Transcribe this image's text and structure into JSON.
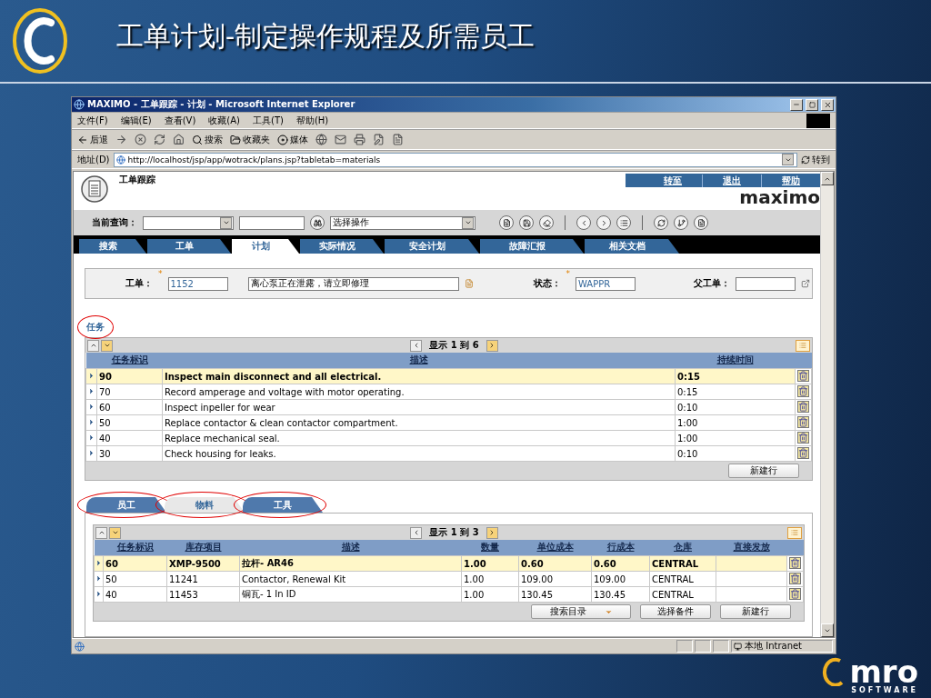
{
  "slide": {
    "title": "工单计划-制定操作规程及所需员工"
  },
  "window": {
    "title": "MAXIMO - 工单跟踪 - 计划 - Microsoft Internet Explorer"
  },
  "menu": [
    "文件(F)",
    "编辑(E)",
    "查看(V)",
    "收藏(A)",
    "工具(T)",
    "帮助(H)"
  ],
  "toolbar": [
    {
      "kind": "back",
      "label": "后退"
    },
    {
      "kind": "forward"
    },
    {
      "kind": "stop"
    },
    {
      "kind": "refresh"
    },
    {
      "kind": "home"
    },
    {
      "kind": "search",
      "label": "搜索"
    },
    {
      "kind": "favorites",
      "label": "收藏夹"
    },
    {
      "kind": "media",
      "label": "媒体"
    },
    {
      "kind": "history"
    },
    {
      "kind": "mail"
    },
    {
      "kind": "print"
    },
    {
      "kind": "edit"
    },
    {
      "kind": "discuss"
    }
  ],
  "address": {
    "label": "地址(D)",
    "url": "http://localhost/jsp/app/wotrack/plans.jsp?tabletab=materials",
    "go": "转到"
  },
  "app": {
    "name": "工单跟踪",
    "links": [
      "转至",
      "退出",
      "帮助"
    ],
    "brand": "maximo",
    "query_label": "当前查询：",
    "action": "选择操作"
  },
  "tabs": [
    {
      "label": "搜索",
      "selected": false
    },
    {
      "label": "工单",
      "selected": false
    },
    {
      "label": "计划",
      "selected": true
    },
    {
      "label": "实际情况",
      "selected": false
    },
    {
      "label": "安全计划",
      "selected": false
    },
    {
      "label": "故障汇报",
      "selected": false
    },
    {
      "label": "相关文档",
      "selected": false
    }
  ],
  "record": {
    "required_mark": "*",
    "wo_label": "工单：",
    "wo": "1152",
    "description": "离心泵正在泄露，请立即修理",
    "status_label": "状态：",
    "status": "WAPPR",
    "parent_label": "父工单："
  },
  "tasks": {
    "title": "任务",
    "circled": true,
    "pager": "显示 1 到 6",
    "columns": [
      "任务标识",
      "描述",
      "持续时间"
    ],
    "rows": [
      {
        "cells": [
          "90",
          "Inspect main disconnect and all electrical.",
          "0:15"
        ],
        "selected": true
      },
      {
        "cells": [
          "70",
          "Record amperage and voltage with motor operating.",
          "0:15"
        ],
        "selected": false
      },
      {
        "cells": [
          "60",
          "Inspect inpeller for wear",
          "0:10"
        ],
        "selected": false
      },
      {
        "cells": [
          "50",
          "Replace contactor & clean contactor compartment.",
          "1:00"
        ],
        "selected": false
      },
      {
        "cells": [
          "40",
          "Replace mechanical seal.",
          "1:00"
        ],
        "selected": false
      },
      {
        "cells": [
          "30",
          "Check housing for leaks.",
          "0:10"
        ],
        "selected": false
      }
    ],
    "buttons": [
      {
        "label": "新建行",
        "kind": "plain"
      }
    ]
  },
  "subtabs": [
    {
      "label": "员工",
      "selected": false,
      "circled": true
    },
    {
      "label": "物料",
      "selected": true,
      "circled": true
    },
    {
      "label": "工具",
      "selected": false,
      "circled": true
    }
  ],
  "materials": {
    "pager": "显示 1 到 3",
    "columns": [
      "任务标识",
      "库存项目",
      "描述",
      "数量",
      "单位成本",
      "行成本",
      "仓库",
      "直接发放"
    ],
    "rows": [
      {
        "cells": [
          "60",
          "XMP-9500",
          "拉杆- AR46",
          "1.00",
          "0.60",
          "0.60",
          "CENTRAL",
          ""
        ],
        "selected": true
      },
      {
        "cells": [
          "50",
          "11241",
          "Contactor, Renewal Kit",
          "1.00",
          "109.00",
          "109.00",
          "CENTRAL",
          ""
        ],
        "selected": false
      },
      {
        "cells": [
          "40",
          "11453",
          "铜瓦- 1 In ID",
          "1.00",
          "130.45",
          "130.45",
          "CENTRAL",
          ""
        ],
        "selected": false
      }
    ],
    "buttons": [
      {
        "label": "搜索目录",
        "kind": "menu"
      },
      {
        "label": "选择备件",
        "kind": "plain"
      },
      {
        "label": "新建行",
        "kind": "plain"
      }
    ]
  },
  "status_bar": {
    "zone": "本地 Intranet"
  },
  "footer_logo": {
    "name": "mro",
    "tagline": "SOFTWARE"
  }
}
